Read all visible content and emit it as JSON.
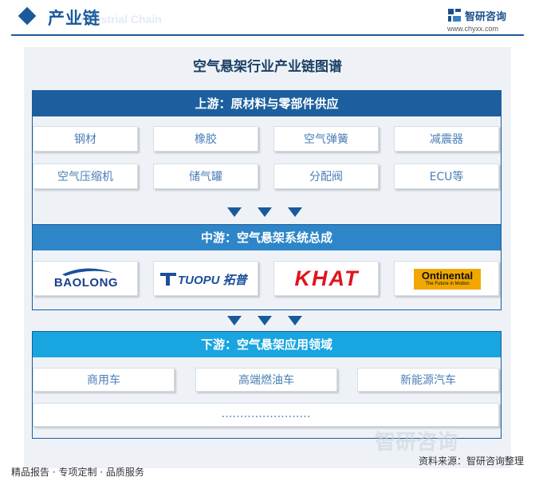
{
  "header": {
    "title": "产业链",
    "subtitle": "Industrial Chain",
    "brand_name": "智研咨询",
    "brand_url": "www.chyxx.com"
  },
  "map_title": "空气悬架行业产业链图谱",
  "upstream": {
    "title": "上游：原材料与零部件供应",
    "items": [
      "钢材",
      "橡胶",
      "空气弹簧",
      "减震器",
      "空气压缩机",
      "储气罐",
      "分配阀",
      "ECU等"
    ]
  },
  "midstream": {
    "title": "中游：空气悬架系统总成",
    "logos": [
      "BAOLONG",
      "TUOPU 拓普",
      "KHAT",
      "Ontinental",
      "The Future in Motion"
    ]
  },
  "downstream": {
    "title": "下游：空气悬架应用领域",
    "items": [
      "商用车",
      "高端燃油车",
      "新能源汽车"
    ],
    "more": "……………………"
  },
  "footer": {
    "left": "精品报告 · 专项定制 · 品质服务",
    "right": "资料来源：智研咨询整理"
  },
  "watermark": "智研咨询",
  "colors": {
    "upstream_bar": "#1d5f9e",
    "midstream_bar": "#2e86c8",
    "downstream_bar": "#19a5e0",
    "arrow": "#1a5a9c",
    "item_text": "#4a7fb5"
  }
}
